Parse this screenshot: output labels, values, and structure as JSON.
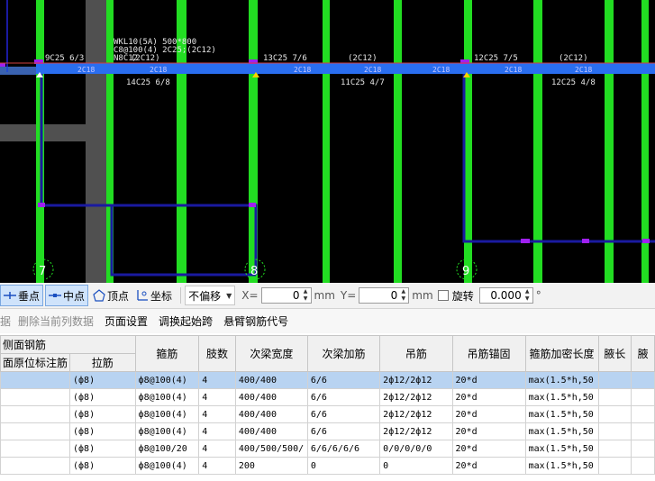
{
  "drawing": {
    "rebar_labels": [
      "9C25 6/3",
      "WKL10(5A) 500*800",
      "C8@100(4) 2C25;(2C12)",
      "N8C12",
      "(2C12)",
      "13C25 7/6",
      "(2C12)",
      "12C25 7/5",
      "(2C12)",
      "14C25 6/8",
      "11C25 4/7",
      "12C25 4/8"
    ],
    "beam_labels": [
      "2C18",
      "2C18",
      "2C18",
      "2C18",
      "2C18",
      "2C18",
      "2C18"
    ],
    "axis_labels": [
      "7",
      "8",
      "9"
    ],
    "colors": {
      "background": "#000000",
      "column": "#22dd22",
      "beam": "#2a6ef0",
      "wall": "#505050",
      "outline": "#1a1aa0",
      "selected_outline": "#a020f0"
    }
  },
  "snap_toolbar": {
    "perpendicular": "垂点",
    "midpoint": "中点",
    "vertex": "顶点",
    "coordinate": "坐标",
    "offset_mode": "不偏移",
    "x_label": "X=",
    "x_value": "0",
    "y_label": "Y=",
    "y_value": "0",
    "unit": "mm",
    "rotate_label": "旋转",
    "rotate_value": "0.000",
    "degree": "°",
    "icons": [
      "perpendicular-snap-icon",
      "midpoint-snap-icon",
      "vertex-snap-icon",
      "coordinate-snap-icon"
    ]
  },
  "menu": {
    "partial": "据",
    "items": [
      "删除当前列数据",
      "页面设置",
      "调换起始跨",
      "悬臂钢筋代号"
    ]
  },
  "table": {
    "group_header": "侧面钢筋",
    "sub_headers": [
      "面原位标注筋",
      "拉筋"
    ],
    "columns": [
      "箍筋",
      "肢数",
      "次梁宽度",
      "次梁加筋",
      "吊筋",
      "吊筋锚固",
      "箍筋加密长度",
      "腋长",
      "腋高"
    ],
    "columns_display": [
      "箍筋",
      "肢数",
      "次梁宽度",
      "次梁加筋",
      "吊筋",
      "吊筋锚固",
      "箍筋加密长度",
      "腋长",
      "腋"
    ],
    "rows": [
      [
        "",
        "(ф8)",
        "ф8@100(4)",
        "4",
        "400/400",
        "6/6",
        "2ф12/2ф12",
        "20*d",
        "max(1.5*h,50",
        "",
        ""
      ],
      [
        "",
        "(ф8)",
        "ф8@100(4)",
        "4",
        "400/400",
        "6/6",
        "2ф12/2ф12",
        "20*d",
        "max(1.5*h,50",
        "",
        ""
      ],
      [
        "",
        "(ф8)",
        "ф8@100(4)",
        "4",
        "400/400",
        "6/6",
        "2ф12/2ф12",
        "20*d",
        "max(1.5*h,50",
        "",
        ""
      ],
      [
        "",
        "(ф8)",
        "ф8@100(4)",
        "4",
        "400/400",
        "6/6",
        "2ф12/2ф12",
        "20*d",
        "max(1.5*h,50",
        "",
        ""
      ],
      [
        "",
        "(ф8)",
        "ф8@100/20",
        "4",
        "400/500/500/",
        "6/6/6/6/6",
        "0/0/0/0/0",
        "20*d",
        "max(1.5*h,50",
        "",
        ""
      ],
      [
        "",
        "(ф8)",
        "ф8@100(4)",
        "4",
        "200",
        "0",
        "0",
        "20*d",
        "max(1.5*h,50",
        "",
        ""
      ]
    ],
    "selected_row": 0
  }
}
